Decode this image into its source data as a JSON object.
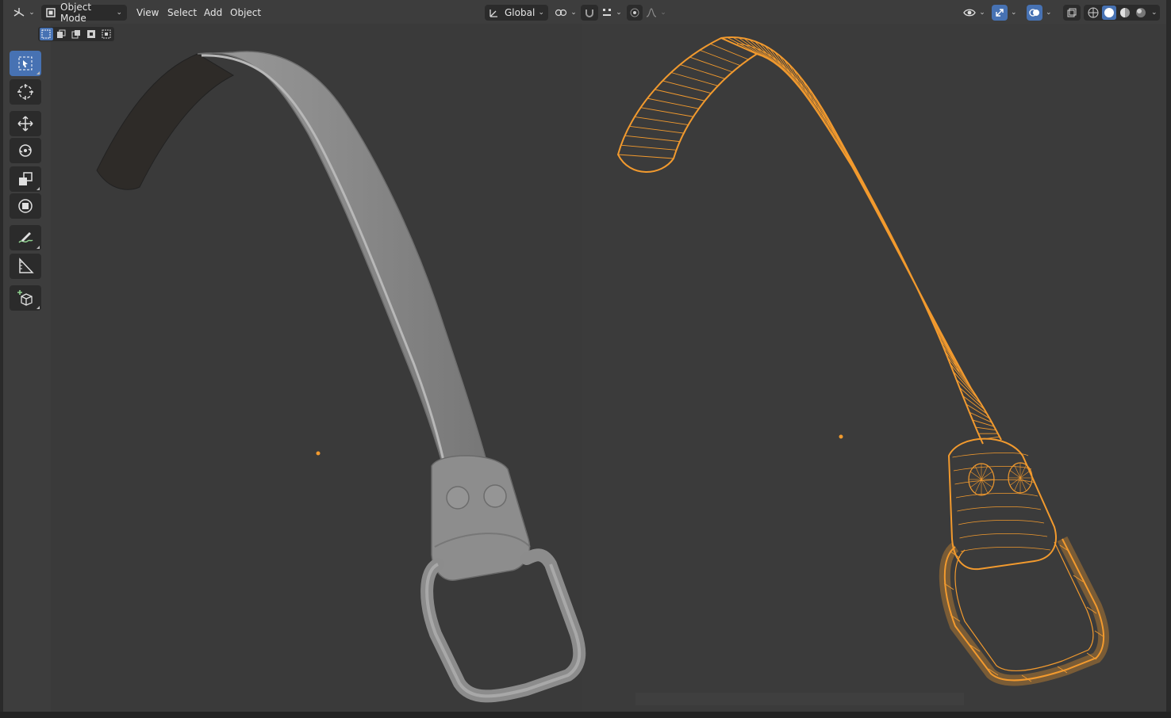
{
  "header": {
    "mode_label": "Object Mode",
    "menus": [
      "View",
      "Select",
      "Add",
      "Object"
    ],
    "transform_orientation": "Global"
  },
  "icons": {
    "editor_type": "view3d-icon",
    "mode": "object-mode-icon",
    "orientation": "transform-orientation-icon",
    "pivot": "pivot-point-icon",
    "snap": "snap-magnet-icon",
    "snap_target": "snap-increment-icon",
    "proportional": "proportional-edit-icon",
    "falloff": "falloff-curve-icon",
    "visibility": "eye-icon",
    "gizmo": "gizmo-icon",
    "overlays": "overlays-icon",
    "xray": "xray-icon",
    "shading_wire": "wireframe-shading-icon",
    "shading_solid": "solid-shading-icon",
    "shading_material": "material-shading-icon",
    "shading_rendered": "rendered-shading-icon"
  },
  "toolbar": [
    "select-box",
    "cursor",
    "move",
    "rotate",
    "scale",
    "transform",
    "annotate",
    "measure",
    "add-cube"
  ],
  "colors": {
    "viewport_bg": "#3d3d3d",
    "header_bg": "#2b2b2b",
    "active_tool": "#4772b3",
    "wire_selected": "#f29a2e",
    "solid_mesh": "#8f8f8f",
    "origin_dot": "#f29a2e"
  }
}
